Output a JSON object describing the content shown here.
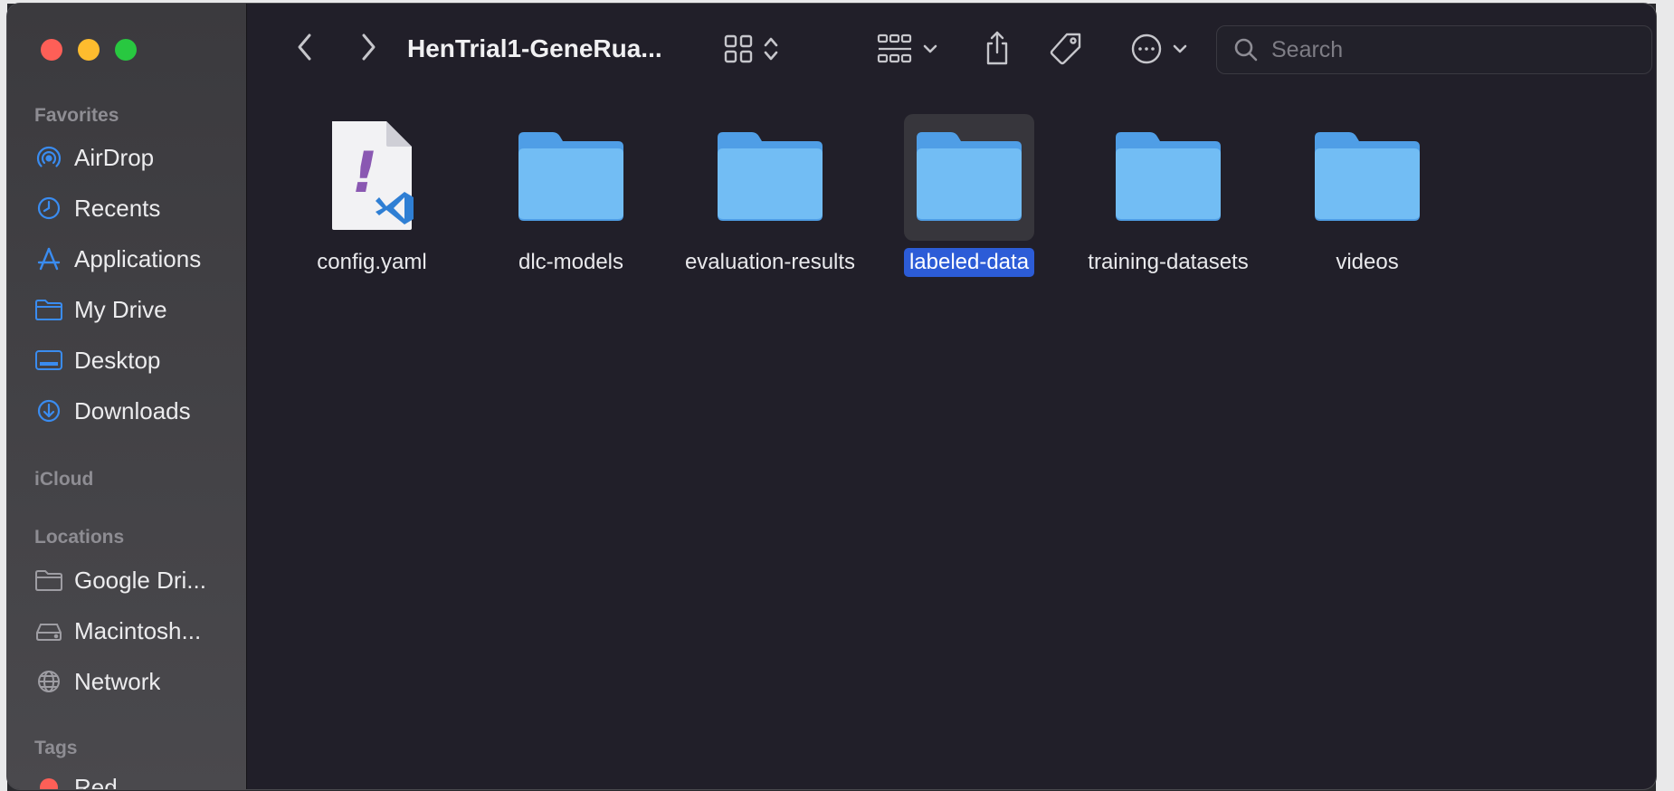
{
  "window": {
    "title": "HenTrial1-GeneRua..."
  },
  "sidebar": {
    "favorites_header": "Favorites",
    "favorites": [
      {
        "label": "AirDrop",
        "icon": "airdrop-icon"
      },
      {
        "label": "Recents",
        "icon": "clock-icon"
      },
      {
        "label": "Applications",
        "icon": "applications-icon"
      },
      {
        "label": "My Drive",
        "icon": "folder-icon"
      },
      {
        "label": "Desktop",
        "icon": "desktop-icon"
      },
      {
        "label": "Downloads",
        "icon": "download-icon"
      }
    ],
    "icloud_header": "iCloud",
    "locations_header": "Locations",
    "locations": [
      {
        "label": "Google Dri...",
        "icon": "folder-icon"
      },
      {
        "label": "Macintosh...",
        "icon": "drive-icon"
      },
      {
        "label": "Network",
        "icon": "globe-icon"
      }
    ],
    "tags_header": "Tags",
    "tags": [
      {
        "label": "Red",
        "color": "#fe5f57"
      }
    ]
  },
  "search": {
    "placeholder": "Search",
    "value": ""
  },
  "files": [
    {
      "name": "config.yaml",
      "type": "file"
    },
    {
      "name": "dlc-models",
      "type": "folder"
    },
    {
      "name": "evaluation-results",
      "type": "folder"
    },
    {
      "name": "labeled-data",
      "type": "folder",
      "selected": true
    },
    {
      "name": "training-datasets",
      "type": "folder"
    },
    {
      "name": "videos",
      "type": "folder"
    }
  ],
  "colors": {
    "accent": "#2c5cd7",
    "folder": "#72bdf4",
    "sidebar_icon": "#3a8cf0"
  }
}
